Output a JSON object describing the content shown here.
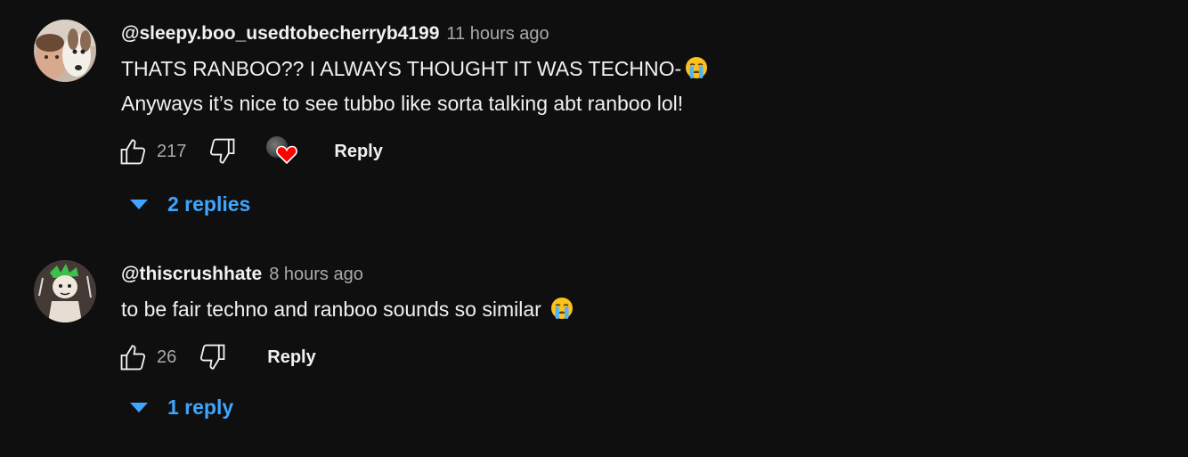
{
  "comments": [
    {
      "author": "@sleepy.boo_usedtobecherryb4199",
      "time": "11 hours ago",
      "lines": [
        "THATS RANBOO?? I ALWAYS THOUGHT IT WAS TECHNO-",
        "Anyways it’s nice to see tubbo like sorta talking abt ranboo lol!"
      ],
      "emoji": "crying-face-emoji",
      "likes": "217",
      "creator_hearted": true,
      "reply_label": "Reply",
      "replies_label": "2 replies"
    },
    {
      "author": "@thiscrushhate",
      "time": "8 hours ago",
      "lines": [
        "to be fair techno and ranboo sounds so similar"
      ],
      "emoji": "crying-face-emoji",
      "likes": "26",
      "creator_hearted": false,
      "reply_label": "Reply",
      "replies_label": "1 reply"
    }
  ],
  "icons": {
    "like": "thumbs-up-icon",
    "dislike": "thumbs-down-icon",
    "heart": "heart-icon",
    "expand": "caret-down-icon"
  },
  "colors": {
    "background": "#0f0f0f",
    "text": "#f1f1f1",
    "secondary_text": "#aaaaaa",
    "link_blue": "#3ea6ff",
    "heart_red": "#ff0000"
  }
}
